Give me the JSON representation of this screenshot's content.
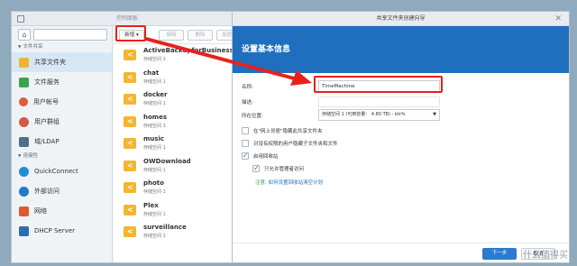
{
  "control_panel": {
    "title": "控制面板",
    "sidebar": {
      "sections": [
        {
          "label": "文件共享",
          "items": [
            {
              "label": "共享文件夹",
              "icon": "shared-folder-icon",
              "active": true
            },
            {
              "label": "文件服务",
              "icon": "file-services-icon"
            },
            {
              "label": "用户帐号",
              "icon": "user-icon"
            },
            {
              "label": "用户群组",
              "icon": "group-icon"
            },
            {
              "label": "域/LDAP",
              "icon": "ldap-icon"
            }
          ]
        },
        {
          "label": "连接性",
          "items": [
            {
              "label": "QuickConnect",
              "icon": "quickconnect-icon"
            },
            {
              "label": "外部访问",
              "icon": "external-access-icon"
            },
            {
              "label": "网络",
              "icon": "network-icon"
            },
            {
              "label": "DHCP Server",
              "icon": "dhcp-icon"
            }
          ]
        }
      ]
    },
    "toolbar": {
      "new": "新增",
      "edit": "编辑",
      "delete": "删除",
      "encrypt": "加密"
    },
    "folders": [
      {
        "name": "ActiveBackupforBusiness",
        "location": "存储空间 1"
      },
      {
        "name": "chat",
        "location": "存储空间 1"
      },
      {
        "name": "docker",
        "location": "存储空间 1"
      },
      {
        "name": "homes",
        "location": "存储空间 1"
      },
      {
        "name": "music",
        "location": "存储空间 1"
      },
      {
        "name": "OWDownload",
        "location": "存储空间 1"
      },
      {
        "name": "photo",
        "location": "存储空间 1"
      },
      {
        "name": "Plex",
        "location": "存储空间 1"
      },
      {
        "name": "surveillance",
        "location": "存储空间 1"
      }
    ]
  },
  "wizard": {
    "title": "共享文件夹创建向导",
    "heading": "设置基本信息",
    "name_label": "名称:",
    "name_value": "TimeMachine",
    "desc_label": "描述:",
    "location_label": "所在位置:",
    "location_value": "存储空间 1 (可用容量： 4.80 TB) - btrfs",
    "checkboxes": [
      {
        "label": "在\"网上邻居\"隐藏此共享文件夹",
        "checked": false
      },
      {
        "label": "对没有权限的用户隐藏子文件夹和文件",
        "checked": false
      },
      {
        "label": "启用回收站",
        "checked": true
      },
      {
        "label": "只允许管理者访问",
        "checked": true
      }
    ],
    "note_key": "注意:",
    "note_link": "如何设置回收站清空计划",
    "buttons": {
      "next": "下一步",
      "cancel": "取消"
    }
  },
  "colors": {
    "accent": "#1f6fbe",
    "highlight": "#e8201c",
    "folder": "#f4b62f"
  },
  "watermark": "什么值得买"
}
